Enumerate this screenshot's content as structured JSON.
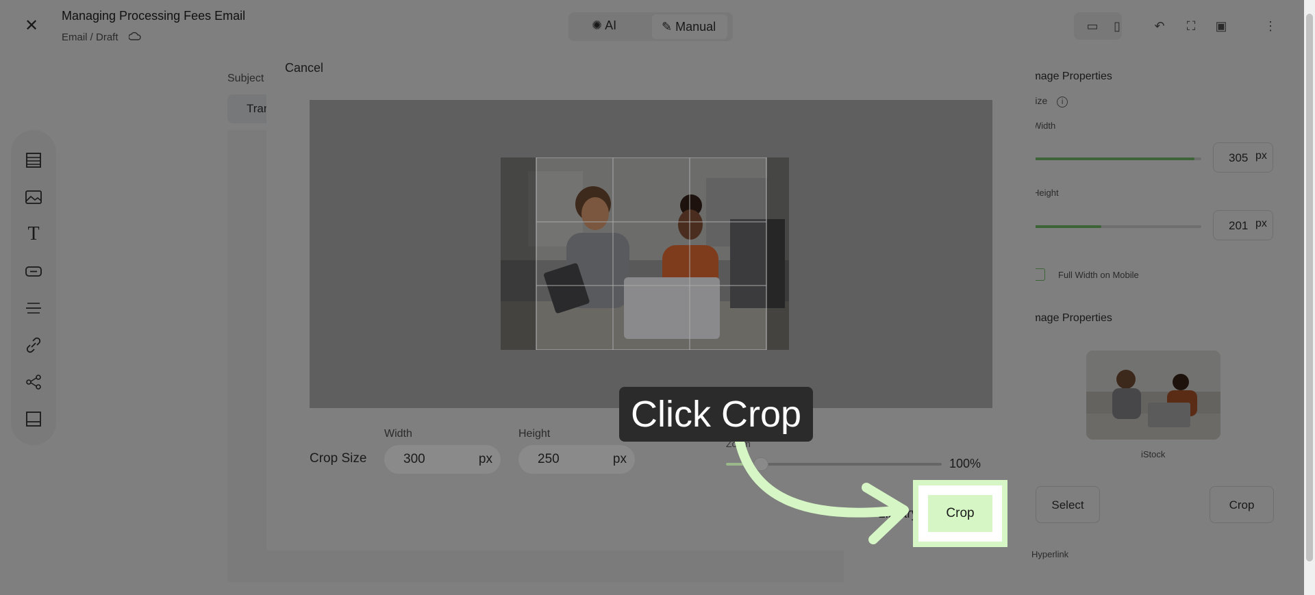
{
  "header": {
    "title": "Managing Processing Fees Email",
    "breadcrumb": "Email / Draft",
    "mode_ai": "AI",
    "mode_manual": "Manual"
  },
  "editor": {
    "subject_label": "Subject",
    "subject_value": "Tran"
  },
  "right_panel": {
    "section1_title": "Image Properties",
    "size_label": "Size",
    "width_label": "Width",
    "width_value": "305",
    "height_label": "Height",
    "height_value": "201",
    "unit": "px",
    "full_width_label": "Full Width on Mobile",
    "section2_title": "Image Properties",
    "image_caption": "iStock",
    "select_label": "Select",
    "crop_label": "Crop",
    "hyperlink_label": "Hyperlink"
  },
  "crop_modal": {
    "cancel_label": "Cancel",
    "crop_size_label": "Crop Size",
    "width_label": "Width",
    "width_value": "300",
    "height_label": "Height",
    "height_value": "250",
    "unit": "px",
    "zoom_label": "Zoom",
    "zoom_value": "100%",
    "library_label": "Library",
    "crop_button_label": "Crop"
  },
  "tooltip": {
    "text": "Click Crop"
  },
  "colors": {
    "highlight": "#d6f7c5",
    "overlay": "#7f7f7f",
    "tooltip_bg": "#2b2b2b"
  }
}
